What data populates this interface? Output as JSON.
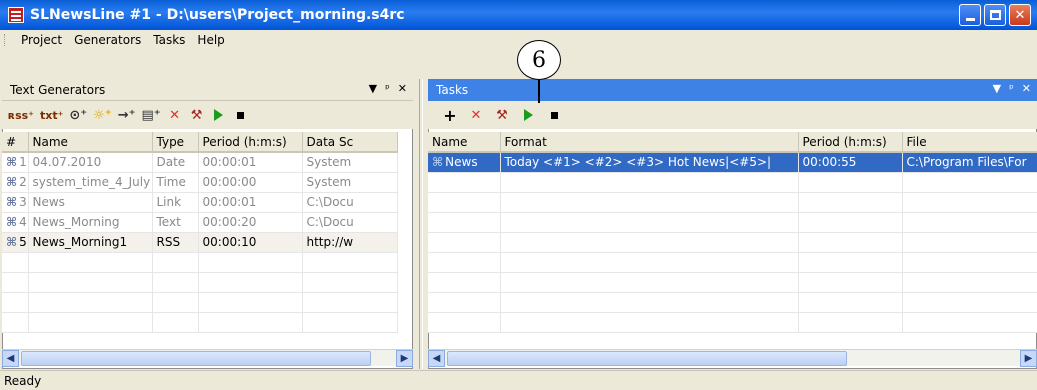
{
  "window": {
    "title": "SLNewsLine #1 - D:\\users\\Project_morning.s4rc"
  },
  "menu": {
    "items": [
      "Project",
      "Generators",
      "Tasks",
      "Help"
    ]
  },
  "callout": {
    "label": "6"
  },
  "left_panel": {
    "title": "Text Generators",
    "header_buttons": [
      "▾",
      "ᵖ",
      "✕"
    ],
    "toolbar": [
      "rss-add",
      "txt-add",
      "time-add",
      "sun-add",
      "link-add",
      "table-add",
      "delete",
      "properties",
      "play",
      "stop"
    ],
    "columns": [
      "#",
      "Name",
      "Type",
      "Period (h:m:s)",
      "Data Sc"
    ],
    "rows": [
      {
        "num": "1",
        "name": "04.07.2010",
        "type": "Date",
        "period": "00:00:01",
        "data": "System"
      },
      {
        "num": "2",
        "name": "system_time_4_July",
        "type": "Time",
        "period": "00:00:00",
        "data": "System"
      },
      {
        "num": "3",
        "name": "News",
        "type": "Link",
        "period": "00:00:01",
        "data": "C:\\Docu"
      },
      {
        "num": "4",
        "name": "News_Morning",
        "type": "Text",
        "period": "00:00:20",
        "data": "C:\\Docu"
      },
      {
        "num": "5",
        "name": "News_Morning1",
        "type": "RSS",
        "period": "00:00:10",
        "data": "http://w"
      }
    ]
  },
  "right_panel": {
    "title": "Tasks",
    "header_buttons": [
      "▾",
      "ᵖ",
      "✕"
    ],
    "columns": [
      "Name",
      "Format",
      "Period (h:m:s)",
      "File"
    ],
    "rows": [
      {
        "name": "News",
        "format": "Today <#1> <#2> <#3> Hot News|<#5>|",
        "period": "00:00:55",
        "file": "C:\\Program Files\\For"
      }
    ]
  },
  "status": {
    "text": "Ready"
  },
  "colors": {
    "title_bar": "#0a5fd6",
    "selection": "#316ac5",
    "tasks_header": "#3f82e6"
  }
}
